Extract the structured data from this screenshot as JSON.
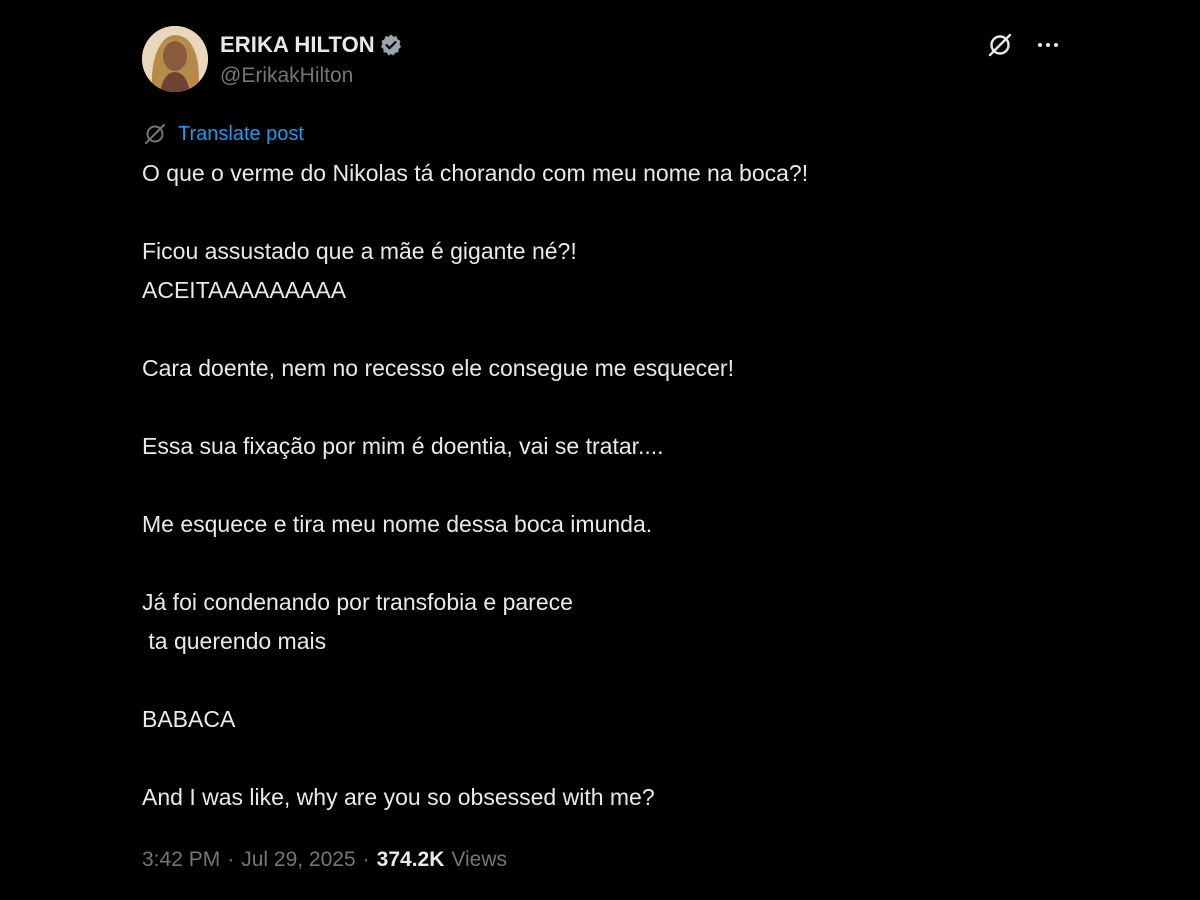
{
  "author": {
    "display_name": "ERIKA HILTON",
    "handle": "@ErikakHilton",
    "verified_badge_color": "#1d9bf0",
    "avatar_icon": "profile-photo"
  },
  "header_actions": {
    "grok_icon": "grok-icon",
    "more_icon": "more-icon"
  },
  "translate": {
    "label": "Translate post",
    "icon": "translate-icon"
  },
  "body": {
    "lines": [
      "O que o verme do Nikolas tá chorando com meu nome na boca?!",
      "",
      "Ficou assustado que a mãe é gigante né?!",
      "ACEITAAAAAAAAA",
      "",
      "Cara doente, nem no recesso ele consegue me esquecer!",
      "",
      "Essa sua fixação por mim é doentia, vai se tratar....",
      "",
      "Me esquece e tira meu nome dessa boca imunda.",
      "",
      "Já foi condenando por transfobia e parece",
      " ta querendo mais",
      "",
      "BABACA",
      "",
      "And I was like, why are you so obsessed with me?"
    ]
  },
  "meta": {
    "time": "3:42 PM",
    "date": "Jul 29, 2025",
    "separator": "·",
    "views_count": "374.2K",
    "views_label": "Views"
  },
  "colors": {
    "background": "#000000",
    "text": "#e7e9ea",
    "secondary": "#71767b",
    "link": "#1d9bf0"
  }
}
